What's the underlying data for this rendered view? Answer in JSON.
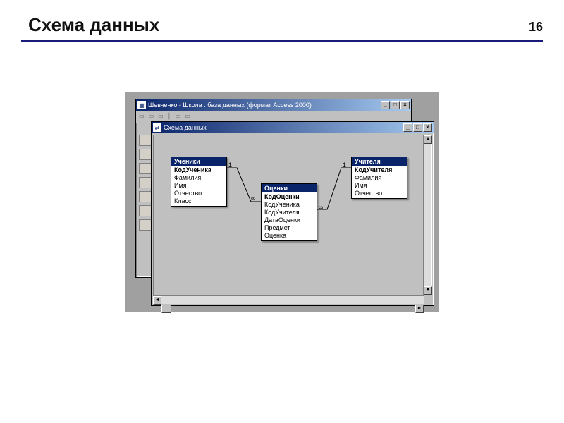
{
  "slide": {
    "title": "Схема данных",
    "page_number": "16"
  },
  "back_window": {
    "title": "Шевченко - Школа : база данных (формат Access 2000)"
  },
  "front_window": {
    "title": "Схема данных"
  },
  "tables": {
    "students": {
      "name": "Ученики",
      "fields": [
        "КодУченика",
        "Фамилия",
        "Имя",
        "Отчество",
        "Класс"
      ],
      "pk_index": 0
    },
    "grades": {
      "name": "Оценки",
      "fields": [
        "КодОценки",
        "КодУченика",
        "КодУчителя",
        "ДатаОценки",
        "Предмет",
        "Оценка"
      ],
      "pk_index": 0
    },
    "teachers": {
      "name": "Учителя",
      "fields": [
        "КодУчителя",
        "Фамилия",
        "Имя",
        "Отчество"
      ],
      "pk_index": 0
    }
  },
  "relations": {
    "students_grades": {
      "left_card": "1",
      "right_card": "∞"
    },
    "teachers_grades": {
      "left_card": "1",
      "right_card": "∞"
    }
  },
  "window_buttons": {
    "minimize": "_",
    "maximize": "□",
    "close": "×"
  },
  "scroll_arrows": {
    "up": "▲",
    "down": "▼",
    "left": "◄",
    "right": "►"
  }
}
